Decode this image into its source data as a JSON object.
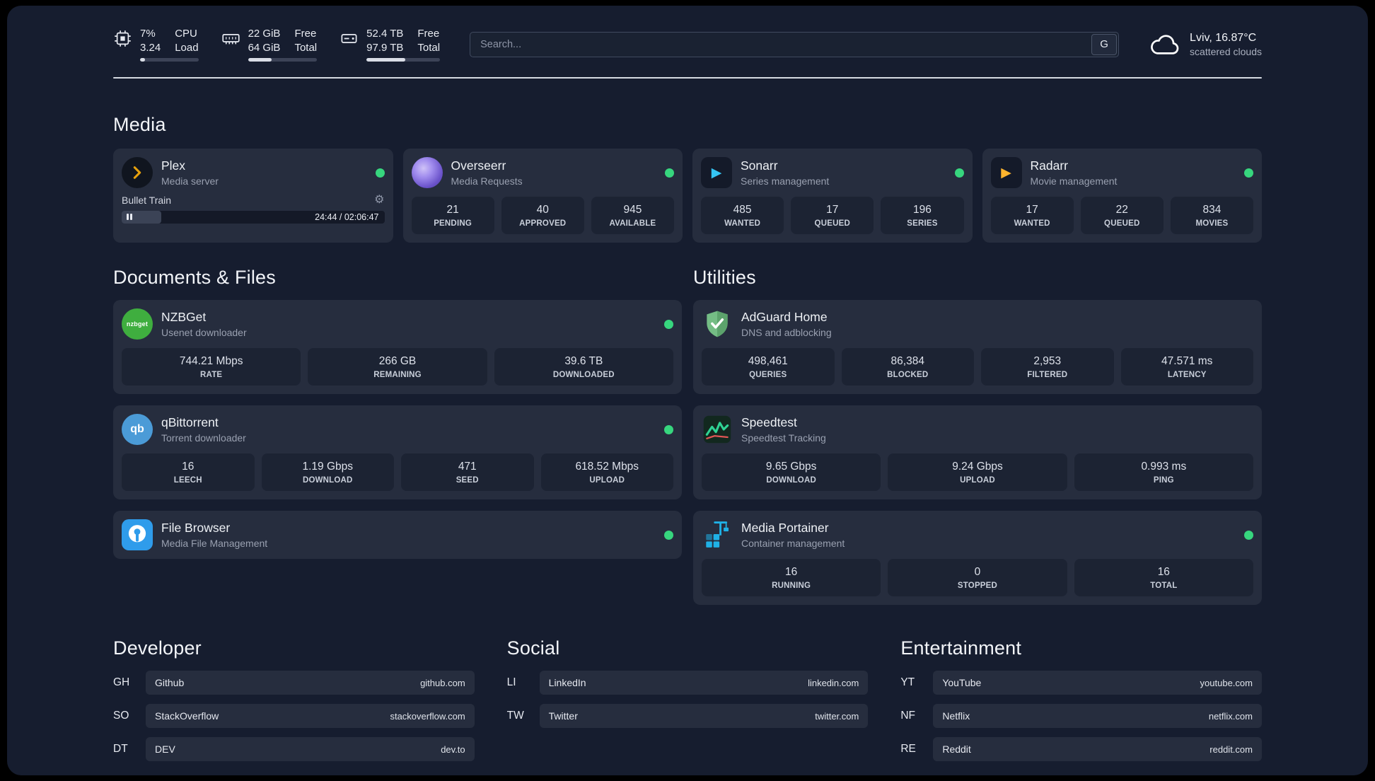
{
  "header": {
    "cpu": {
      "value": "7%",
      "secondary": "3.24",
      "label_top": "CPU",
      "label_bottom": "Load",
      "bar_percent": 8
    },
    "ram": {
      "value": "22 GiB",
      "secondary": "64 GiB",
      "label_top": "Free",
      "label_bottom": "Total",
      "bar_percent": 34
    },
    "disk": {
      "value": "52.4 TB",
      "secondary": "97.9 TB",
      "label_top": "Free",
      "label_bottom": "Total",
      "bar_percent": 53
    },
    "search": {
      "placeholder": "Search...",
      "engine_badge": "G"
    },
    "weather": {
      "location": "Lviv, 16.87°C",
      "condition": "scattered clouds"
    }
  },
  "media": {
    "title": "Media",
    "plex": {
      "name": "Plex",
      "subtitle": "Media server",
      "now_playing": "Bullet Train",
      "elapsed": "24:44 / 02:06:47",
      "gear_glyph": "⚙",
      "progress_percent": 15
    },
    "overseerr": {
      "name": "Overseerr",
      "subtitle": "Media Requests",
      "stats": [
        {
          "value": "21",
          "label": "PENDING"
        },
        {
          "value": "40",
          "label": "APPROVED"
        },
        {
          "value": "945",
          "label": "AVAILABLE"
        }
      ]
    },
    "sonarr": {
      "name": "Sonarr",
      "subtitle": "Series management",
      "play_glyph": "▶",
      "stats": [
        {
          "value": "485",
          "label": "WANTED"
        },
        {
          "value": "17",
          "label": "QUEUED"
        },
        {
          "value": "196",
          "label": "SERIES"
        }
      ]
    },
    "radarr": {
      "name": "Radarr",
      "subtitle": "Movie management",
      "play_glyph": "▶",
      "stats": [
        {
          "value": "17",
          "label": "WANTED"
        },
        {
          "value": "22",
          "label": "QUEUED"
        },
        {
          "value": "834",
          "label": "MOVIES"
        }
      ]
    }
  },
  "documents": {
    "title": "Documents & Files",
    "nzbget": {
      "name": "NZBGet",
      "subtitle": "Usenet downloader",
      "icon_text": "nzbget",
      "stats": [
        {
          "value": "744.21 Mbps",
          "label": "RATE"
        },
        {
          "value": "266 GB",
          "label": "REMAINING"
        },
        {
          "value": "39.6 TB",
          "label": "DOWNLOADED"
        }
      ]
    },
    "qbittorrent": {
      "name": "qBittorrent",
      "subtitle": "Torrent downloader",
      "icon_text": "qb",
      "stats": [
        {
          "value": "16",
          "label": "LEECH"
        },
        {
          "value": "1.19 Gbps",
          "label": "DOWNLOAD"
        },
        {
          "value": "471",
          "label": "SEED"
        },
        {
          "value": "618.52 Mbps",
          "label": "UPLOAD"
        }
      ]
    },
    "filebrowser": {
      "name": "File Browser",
      "subtitle": "Media File Management"
    }
  },
  "utilities": {
    "title": "Utilities",
    "adguard": {
      "name": "AdGuard Home",
      "subtitle": "DNS and adblocking",
      "stats": [
        {
          "value": "498,461",
          "label": "QUERIES"
        },
        {
          "value": "86,384",
          "label": "BLOCKED"
        },
        {
          "value": "2,953",
          "label": "FILTERED"
        },
        {
          "value": "47.571 ms",
          "label": "LATENCY"
        }
      ]
    },
    "speedtest": {
      "name": "Speedtest",
      "subtitle": "Speedtest Tracking",
      "stats": [
        {
          "value": "9.65 Gbps",
          "label": "DOWNLOAD"
        },
        {
          "value": "9.24 Gbps",
          "label": "UPLOAD"
        },
        {
          "value": "0.993 ms",
          "label": "PING"
        }
      ]
    },
    "portainer": {
      "name": "Media Portainer",
      "subtitle": "Container management",
      "stats": [
        {
          "value": "16",
          "label": "RUNNING"
        },
        {
          "value": "0",
          "label": "STOPPED"
        },
        {
          "value": "16",
          "label": "TOTAL"
        }
      ]
    }
  },
  "bookmarks": {
    "developer": {
      "title": "Developer",
      "items": [
        {
          "abbr": "GH",
          "name": "Github",
          "url": "github.com"
        },
        {
          "abbr": "SO",
          "name": "StackOverflow",
          "url": "stackoverflow.com"
        },
        {
          "abbr": "DT",
          "name": "DEV",
          "url": "dev.to"
        }
      ]
    },
    "social": {
      "title": "Social",
      "items": [
        {
          "abbr": "LI",
          "name": "LinkedIn",
          "url": "linkedin.com"
        },
        {
          "abbr": "TW",
          "name": "Twitter",
          "url": "twitter.com"
        }
      ]
    },
    "entertainment": {
      "title": "Entertainment",
      "items": [
        {
          "abbr": "YT",
          "name": "YouTube",
          "url": "youtube.com"
        },
        {
          "abbr": "NF",
          "name": "Netflix",
          "url": "netflix.com"
        },
        {
          "abbr": "RE",
          "name": "Reddit",
          "url": "reddit.com"
        }
      ]
    }
  },
  "colors": {
    "background": "#161D2F",
    "card": "#262D3E",
    "tile": "#1C2333",
    "status_online": "#37D67E",
    "plex": "#E5A00D",
    "overseerr": "#7B5BD6",
    "sonarr": "#35C5F4",
    "radarr": "#FFB52E",
    "nzbget": "#3FAE3F",
    "qbittorrent": "#4B9BD7",
    "filebrowser": "#2F9CEB",
    "adguard": "#68B279",
    "speedtest": "#2FD394",
    "portainer": "#1FB1E6"
  },
  "icons": {
    "header": [
      "cpu-icon",
      "ram-icon",
      "hard-drive-icon",
      "cloud-icon"
    ],
    "apps": [
      "plex-icon",
      "overseerr-icon",
      "sonarr-icon",
      "radarr-icon",
      "nzbget-icon",
      "qbittorrent-icon",
      "filebrowser-icon",
      "adguard-icon",
      "speedtest-icon",
      "portainer-icon"
    ],
    "misc": [
      "gear-icon",
      "pause-icon",
      "search-engine-badge"
    ]
  }
}
